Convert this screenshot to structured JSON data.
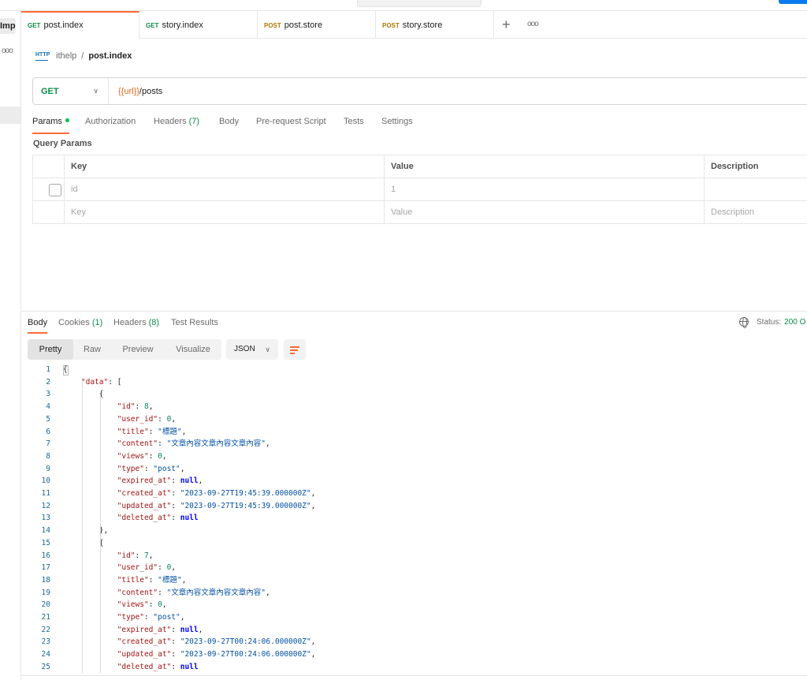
{
  "sidebar": {
    "import_label": "Import",
    "more_glyph": "ooo"
  },
  "tabs": [
    {
      "method": "GET",
      "name": "post.index",
      "method_type": "get"
    },
    {
      "method": "GET",
      "name": "story.index",
      "method_type": "get"
    },
    {
      "method": "POST",
      "name": "post.store",
      "method_type": "post"
    },
    {
      "method": "POST",
      "name": "story.store",
      "method_type": "post"
    }
  ],
  "tab_controls": {
    "plus": "+",
    "more": "ooo"
  },
  "breadcrumb": {
    "icon_text": "HTTP",
    "parent": "ithelp",
    "separator": "/",
    "current": "post.index"
  },
  "request": {
    "method": "GET",
    "url_var": "{{url}}",
    "url_path": "/posts"
  },
  "request_tabs": {
    "params": "Params",
    "authorization": "Authorization",
    "headers": "Headers",
    "headers_count": "(7)",
    "body": "Body",
    "prerequest": "Pre-request Script",
    "tests": "Tests",
    "settings": "Settings"
  },
  "query_params": {
    "title": "Query Params",
    "headers": [
      "Key",
      "Value",
      "Description"
    ],
    "rows": [
      {
        "key": "id",
        "value": "1",
        "description": ""
      }
    ],
    "placeholder": {
      "key": "Key",
      "value": "Value",
      "description": "Description"
    }
  },
  "response": {
    "tabs": {
      "body": "Body",
      "cookies": "Cookies",
      "cookies_count": "(1)",
      "headers": "Headers",
      "headers_count": "(8)",
      "test_results": "Test Results"
    },
    "status_label": "Status:",
    "status_value": "200 O",
    "views": [
      "Pretty",
      "Raw",
      "Preview",
      "Visualize"
    ],
    "format": "JSON"
  },
  "code": {
    "records": [
      {
        "id": "8",
        "user_id": "0",
        "title": "標題",
        "content": "文章內容文章內容文章內容",
        "views": "0",
        "type": "post",
        "expired_at": "null",
        "created_at": "2023-09-27T19:45:39.000000Z",
        "updated_at": "2023-09-27T19:45:39.000000Z",
        "deleted_at": "null"
      },
      {
        "id": "7",
        "user_id": "0",
        "title": "標題",
        "content": "文章內容文章內容文章內容",
        "views": "0",
        "type": "post",
        "expired_at": "null",
        "created_at": "2023-09-27T00:24:06.000000Z",
        "updated_at": "2023-09-27T00:24:06.000000Z",
        "deleted_at": "null"
      }
    ]
  },
  "colors": {
    "accent": "#ff6c37",
    "get": "#0f8a4a",
    "post": "#ad7a03",
    "var": "#e56a19"
  }
}
